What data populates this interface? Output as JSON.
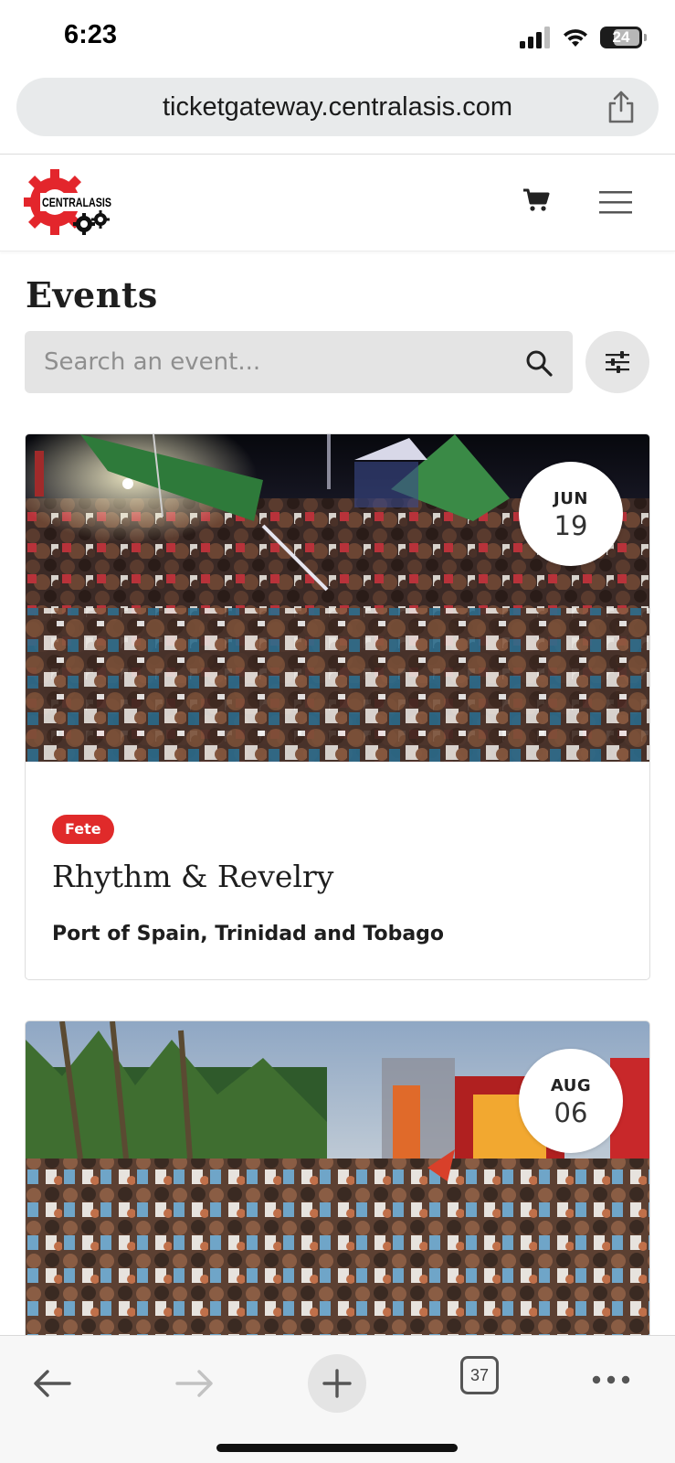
{
  "status_bar": {
    "time": "6:23",
    "battery_level": "24",
    "icons": [
      "signal-icon",
      "wifi-icon",
      "battery-icon"
    ]
  },
  "browser": {
    "url": "ticketgateway.centralasis.com",
    "share_icon": "share-icon"
  },
  "site_header": {
    "logo_text": "CENTRALASIS",
    "cart_icon": "cart-icon",
    "menu_icon": "hamburger-menu-icon"
  },
  "events_page": {
    "title": "Events",
    "search_placeholder": "Search an event...",
    "filter_icon": "sliders-icon"
  },
  "events": [
    {
      "month": "JUN",
      "day": "19",
      "category": "Fete",
      "title": "Rhythm & Revelry",
      "location": "Port of Spain, Trinidad and Tobago"
    },
    {
      "month": "AUG",
      "day": "06"
    }
  ],
  "bottom_toolbar": {
    "tab_count": "37",
    "icons": [
      "back-arrow-icon",
      "forward-arrow-icon",
      "plus-icon",
      "tabs-icon",
      "more-icon"
    ]
  },
  "colors": {
    "accent_red": "#e02a2a",
    "logo_red": "#e3262c",
    "search_bg": "#e4e4e4",
    "url_bar_bg": "#e8eaeb"
  }
}
